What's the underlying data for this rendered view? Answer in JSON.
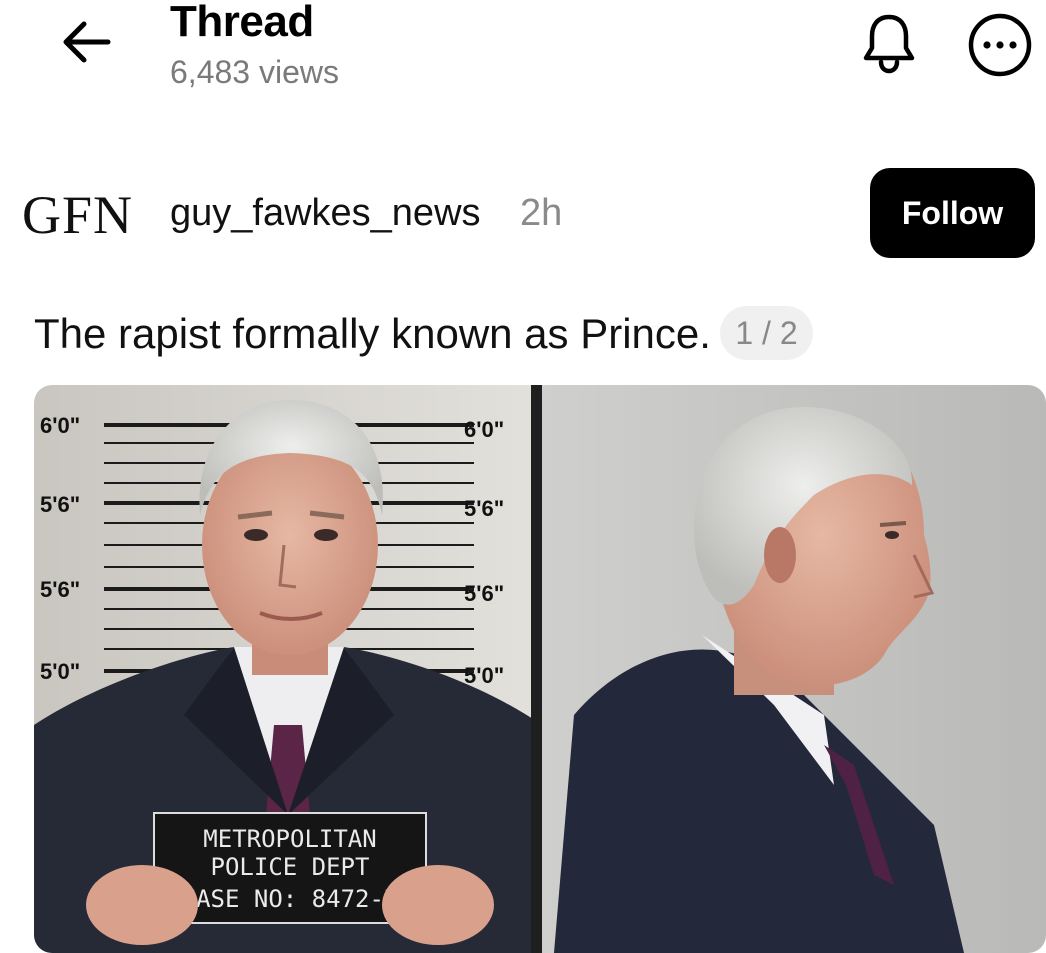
{
  "header": {
    "title": "Thread",
    "views": "6,483 views",
    "back_icon": "arrow-left-icon",
    "bell_icon": "bell-icon",
    "more_icon": "more-horizontal-icon"
  },
  "post": {
    "author_avatar": "GFN",
    "author_name": "guy_fawkes_news",
    "time": "2h",
    "follow_label": "Follow",
    "text": "The rapist formally known as Prince.",
    "page_indicator": "1 / 2",
    "image": {
      "height_marks_left": [
        "6'0\"",
        "5'6\"",
        "5'6\"",
        "5'0\""
      ],
      "height_marks_right": [
        "6'0\"",
        "5'6\"",
        "5'6\"",
        "5'0\""
      ],
      "placard_line1": "METROPOLITAN",
      "placard_line2": "POLICE DEPT",
      "placard_line3": "CASE NO: 8472-B"
    }
  },
  "colors": {
    "follow_bg": "#000000",
    "follow_text": "#ffffff",
    "muted_text": "#7a7a7a",
    "badge_bg": "#f0f0f0"
  }
}
